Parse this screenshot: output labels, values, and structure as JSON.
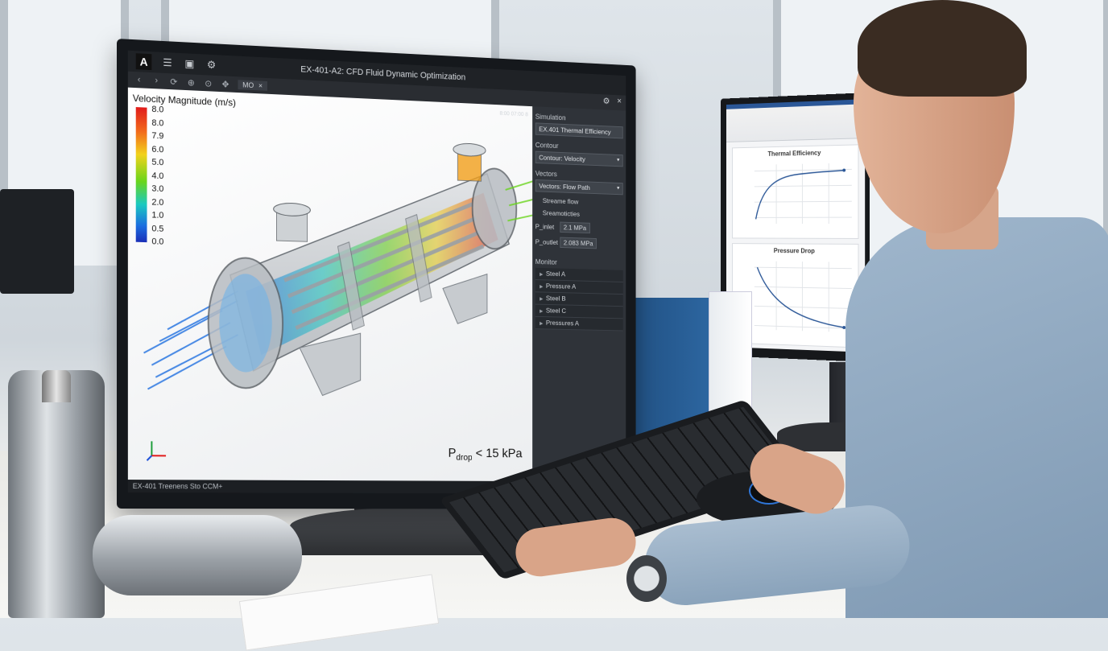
{
  "app": {
    "title": "EX-401-A2: CFD Fluid Dynamic Optimization",
    "logo": "A",
    "doc_tab": "MO",
    "status_text": "EX-401 Treenens Sto CCM+",
    "coord_readout": "8:00 07:00 8"
  },
  "titlebar_icons": [
    "menu-icon",
    "save-icon",
    "settings-icon"
  ],
  "toolbar_icons": [
    "back-icon",
    "forward-icon",
    "rotate-icon",
    "zoom-in-icon",
    "zoom-fit-icon",
    "pan-icon"
  ],
  "legend": {
    "title": "Velocity Magnitude (m/s)",
    "labels": [
      "8.0",
      "8.0",
      "7.9",
      "6.0",
      "5.0",
      "4.0",
      "3.0",
      "2.0",
      "1.0",
      "0.5",
      "0.0"
    ]
  },
  "annotation": {
    "p": "P",
    "sub": "drop",
    "rest": " < 15 kPa"
  },
  "panel": {
    "simulation_label": "Simulation",
    "simulation_value": "EX.401 Thermal Efficiency",
    "contour_label": "Contour",
    "contour_value": "Contour: Velocity",
    "vectors_label": "Vectors",
    "vectors_value": "Vectors: Flow Path",
    "check1": "Streame flow",
    "check2": "Sreamoticties",
    "p_inlet_label": "P_inlet",
    "p_inlet_value": "2.1 MPa",
    "p_outlet_label": "P_outlet",
    "p_outlet_value": "2.083 MPa",
    "monitor_label": "Monitor",
    "tree": [
      "Steel A",
      "Pressure A",
      "Steel B",
      "Steel C",
      "Pressures A"
    ]
  },
  "secondary": {
    "chart1_title": "Thermal Efficiency",
    "chart2_title": "Pressure Drop"
  },
  "colors": {
    "accent": "#2b5797",
    "legend_high": "#e11b1b",
    "legend_low": "#1b2fb8"
  }
}
